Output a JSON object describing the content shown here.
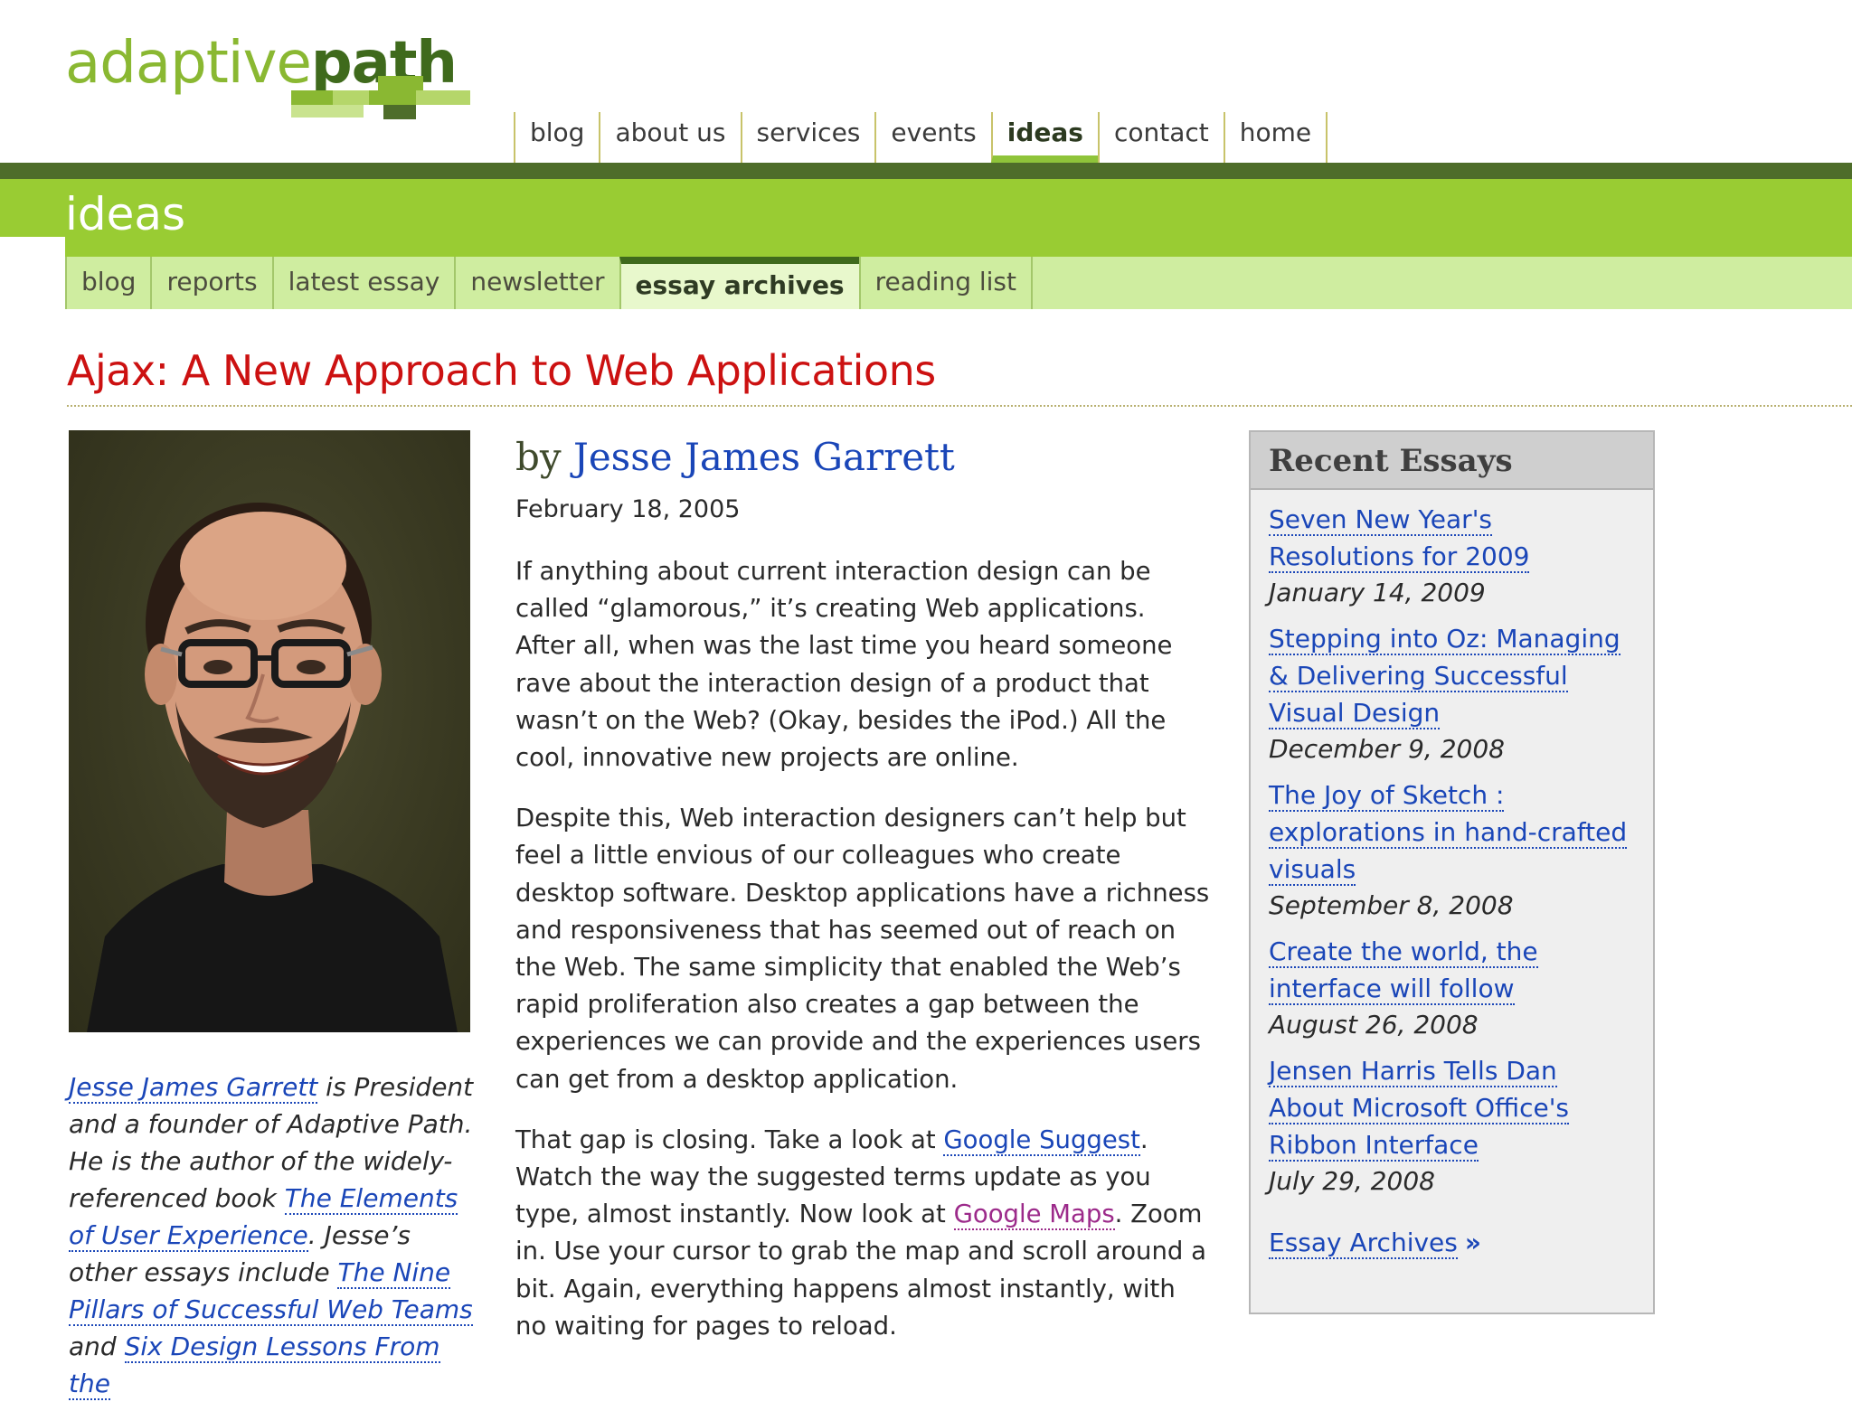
{
  "logo": {
    "light": "adaptive",
    "bold": "path"
  },
  "top_nav": [
    {
      "label": "blog"
    },
    {
      "label": "about us"
    },
    {
      "label": "services"
    },
    {
      "label": "events"
    },
    {
      "label": "ideas",
      "active": true
    },
    {
      "label": "contact"
    },
    {
      "label": "home"
    }
  ],
  "section": {
    "title": "ideas"
  },
  "sub_nav": [
    {
      "label": "blog"
    },
    {
      "label": "reports"
    },
    {
      "label": "latest essay"
    },
    {
      "label": "newsletter"
    },
    {
      "label": "essay archives",
      "active": true
    },
    {
      "label": "reading list"
    }
  ],
  "article": {
    "title": "Ajax: A New Approach to Web Applications",
    "byline_prefix": "by",
    "author": "Jesse James Garrett",
    "date": "February 18, 2005",
    "p1": "If anything about current interaction design can be called “glamorous,” it’s creating Web applications. After all, when was the last time you heard someone rave about the interaction design of a product that wasn’t on the Web? (Okay, besides the iPod.) All the cool, innovative new projects are online.",
    "p2": "Despite this, Web interaction designers can’t help but feel a little envious of our colleagues who create desktop software. Desktop applications have a richness and responsiveness that has seemed out of reach on the Web. The same simplicity that enabled the Web’s rapid proliferation also creates a gap between the experiences we can provide and the experiences users can get from a desktop application.",
    "p3_a": "That gap is closing. Take a look at ",
    "p3_link1": "Google Suggest",
    "p3_b": ". Watch the way the suggested terms update as you type, almost instantly. Now look at ",
    "p3_link2": "Google Maps",
    "p3_c": ". Zoom in. Use your cursor to grab the map and scroll around a bit. Again, everything happens almost instantly, with no waiting for pages to reload."
  },
  "bio": {
    "name_link": "Jesse James Garrett",
    "text1": " is President and a founder of Adaptive Path. He is the author of the widely-referenced book ",
    "book_link": "The Elements of User Experience",
    "text2": ". Jesse’s other essays include ",
    "essay_link1": "The Nine Pillars of Successful Web Teams",
    "text3": " and ",
    "essay_link2": "Six Design Lessons From the"
  },
  "sidebar": {
    "heading": "Recent Essays",
    "essays": [
      {
        "title": "Seven New Year's Resolutions for 2009",
        "date": "January 14, 2009"
      },
      {
        "title": "Stepping into Oz: Managing & Delivering Successful Visual Design",
        "date": "December 9, 2008"
      },
      {
        "title": "The Joy of Sketch : explorations in hand-crafted visuals",
        "date": "September 8, 2008"
      },
      {
        "title": "Create the world, the interface will follow",
        "date": "August 26, 2008"
      },
      {
        "title": "Jensen Harris Tells Dan About Microsoft Office's Ribbon Interface",
        "date": "July 29, 2008"
      }
    ],
    "archives_label": "Essay Archives",
    "archives_arrow": "»"
  },
  "colors": {
    "brand_green": "#99cc33",
    "dark_green": "#4e6d2a",
    "title_red": "#cc1111",
    "link_blue": "#1a46b8",
    "visited_purple": "#9c2a8a"
  }
}
